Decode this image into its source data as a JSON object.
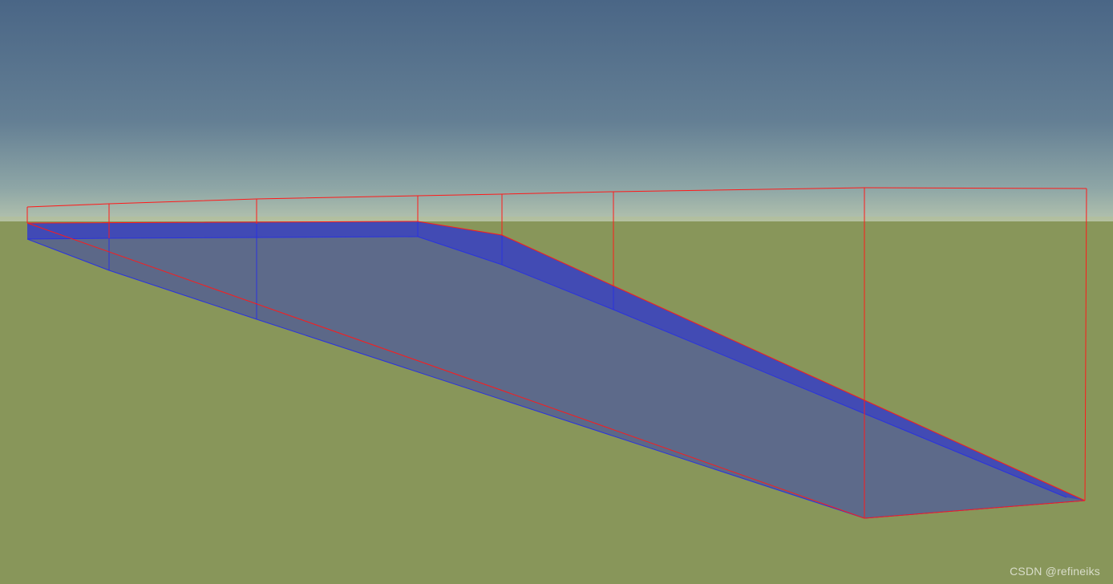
{
  "watermark": {
    "text": "CSDN @refineiks"
  },
  "colors": {
    "sky_top": "#4a6686",
    "sky_mid": "#6a8799",
    "sky_horizon": "#a8b8ad",
    "ground": "#88965a",
    "mesh_top_face": "#5d6a8a",
    "mesh_side_face": "#3f48b8",
    "mesh_edges": "#2a33dd",
    "bounding_box": "#ff1a1a"
  }
}
